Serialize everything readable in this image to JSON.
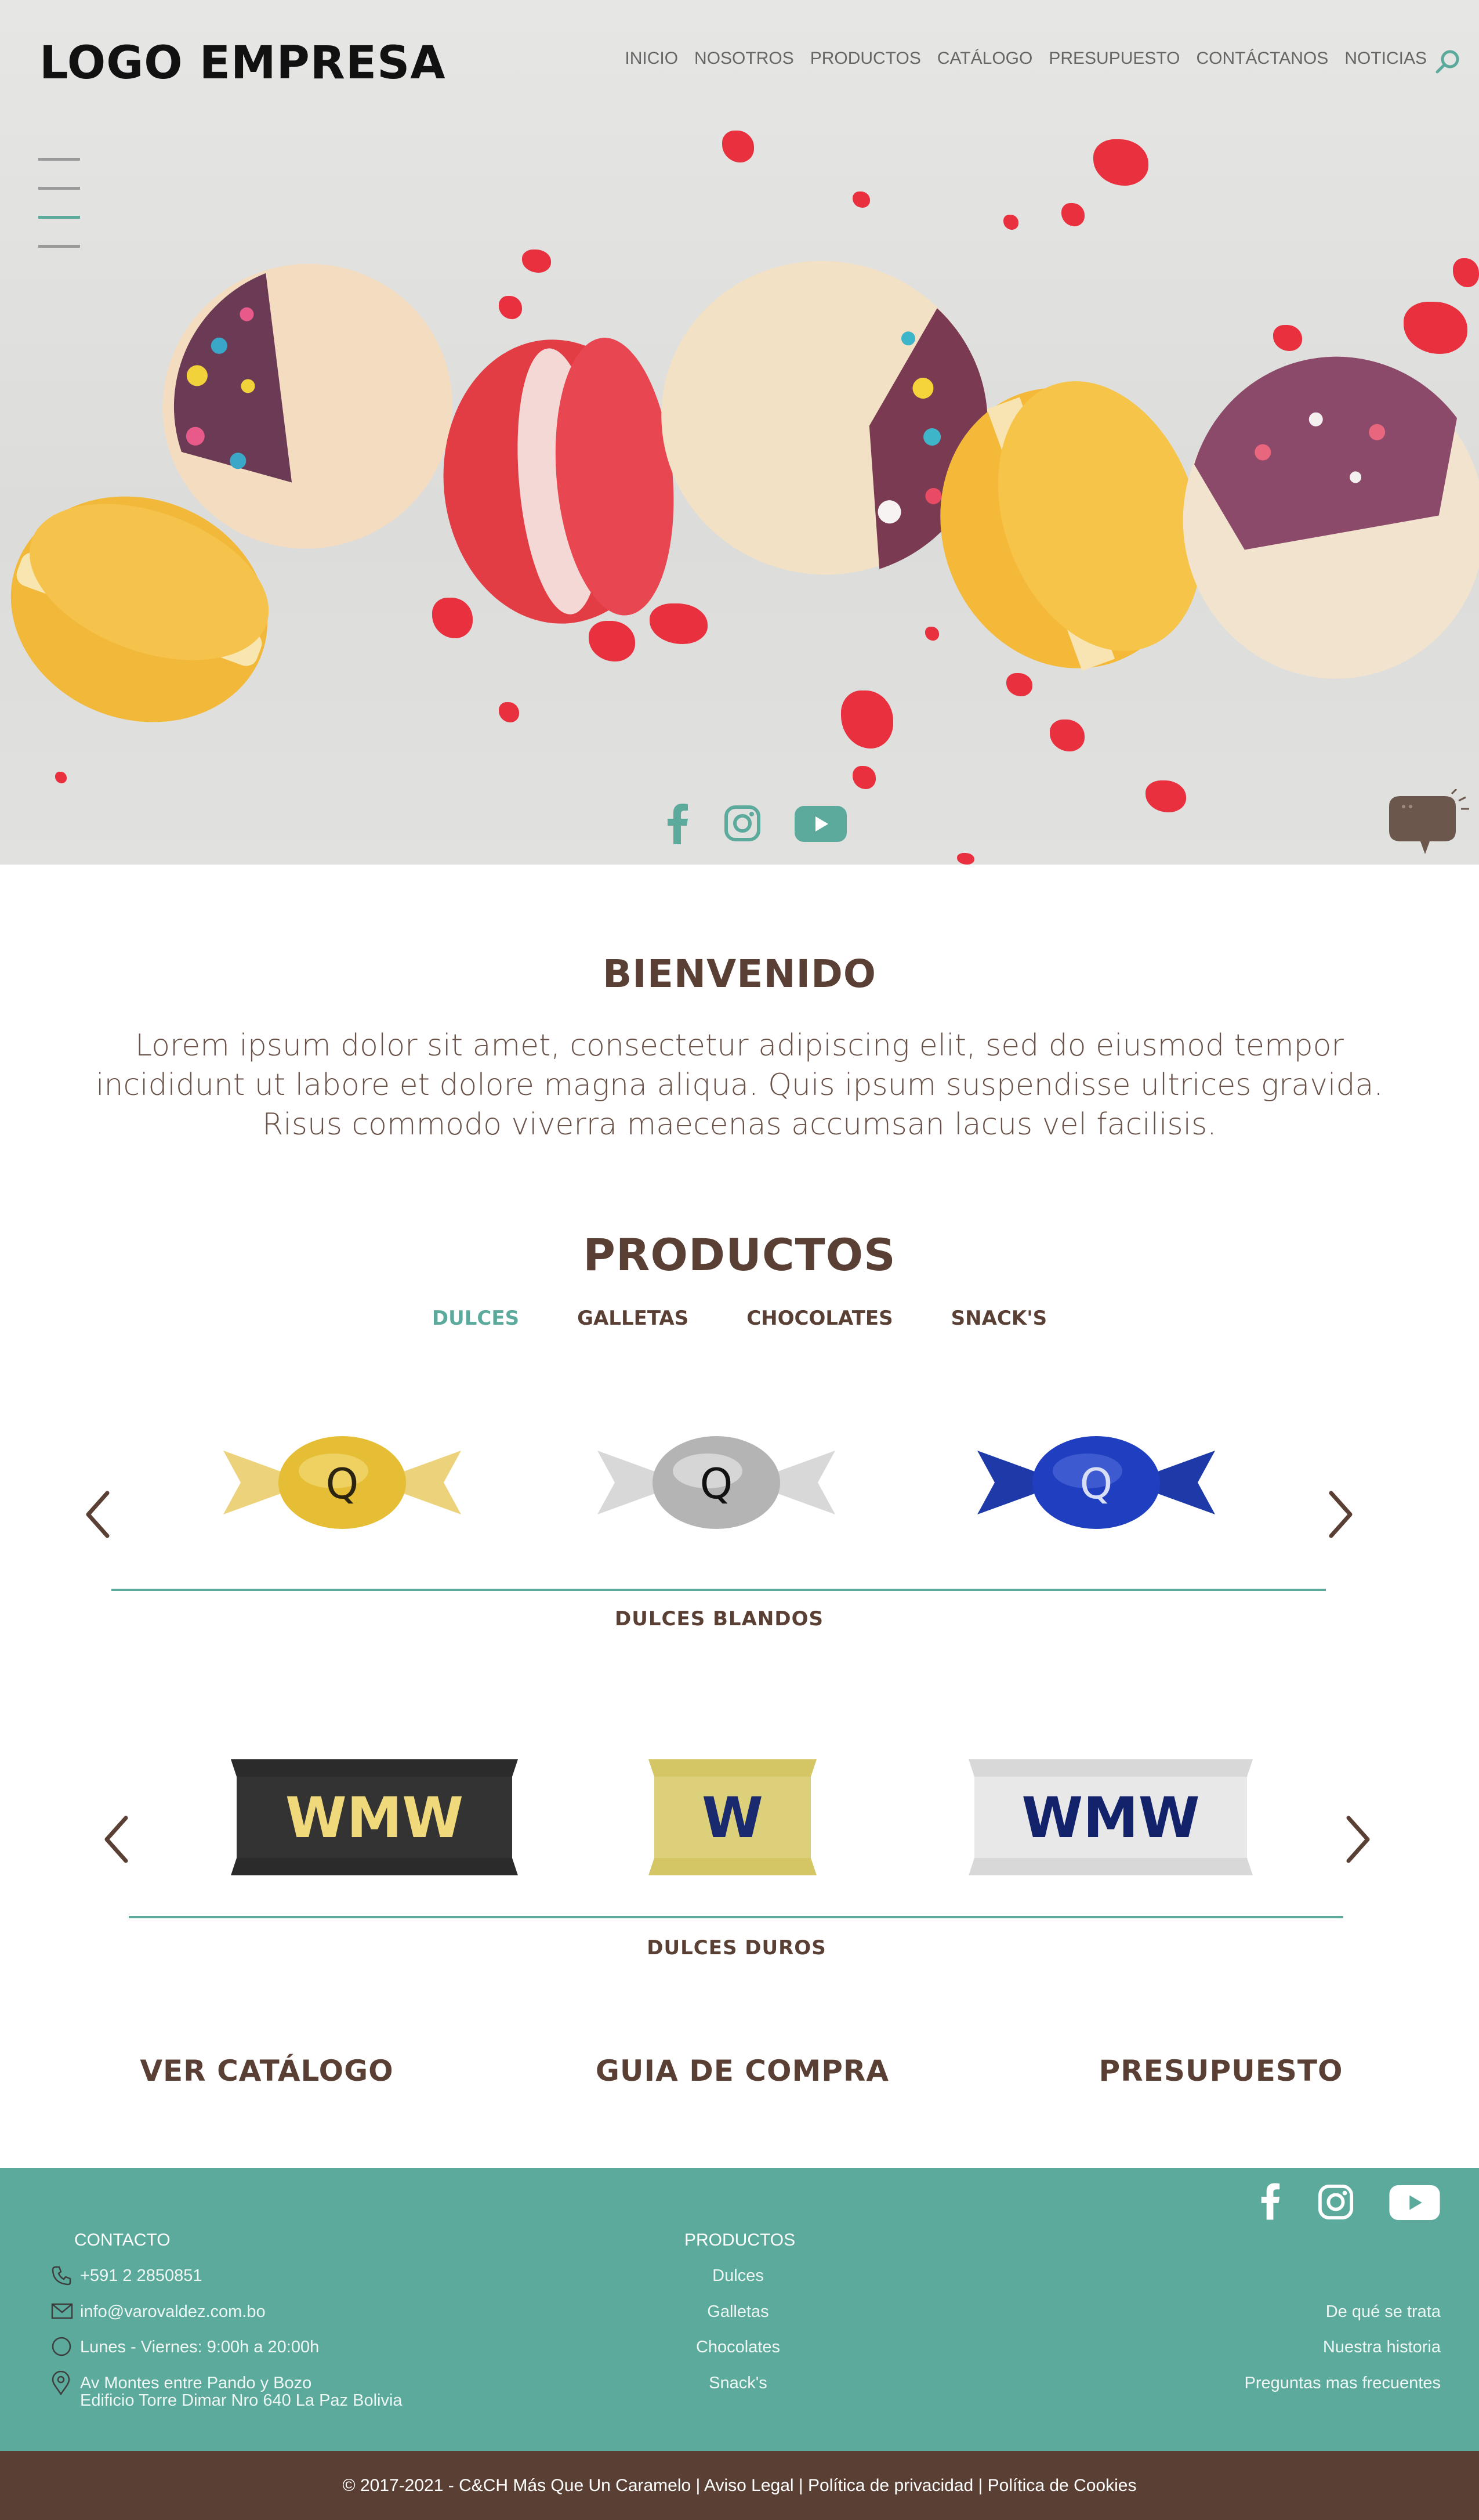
{
  "header": {
    "logo": "LOGO EMPRESA",
    "nav": [
      "INICIO",
      "NOSOTROS",
      "PRODUCTOS",
      "CATÁLOGO",
      "PRESUPUESTO",
      "CONTÁCTANOS",
      "NOTICIAS"
    ]
  },
  "hero": {
    "social_icons": [
      "facebook-icon",
      "instagram-icon",
      "youtube-icon"
    ],
    "chat_icon": "chat-bubble-icon"
  },
  "welcome": {
    "title": "BIENVENIDO",
    "text": "Lorem ipsum dolor sit amet, consectetur adipiscing elit, sed do eiusmod tempor incididunt ut labore et dolore magna aliqua. Quis ipsum suspendisse ultrices gravida. Risus commodo viverra maecenas accumsan lacus vel facilisis."
  },
  "products": {
    "title": "PRODUCTOS",
    "tabs": [
      "DULCES",
      "GALLETAS",
      "CHOCOLATES",
      "SNACK'S"
    ],
    "active_tab": "DULCES",
    "soft_candies": {
      "label": "DULCES BLANDOS",
      "items": [
        {
          "mark": "Q",
          "wrapper_color": "#e8c23c"
        },
        {
          "mark": "Q",
          "wrapper_color": "#b8b8b8"
        },
        {
          "mark": "Q",
          "wrapper_color": "#1f3fb8"
        }
      ]
    },
    "hard_candies": {
      "label": "DULCES DUROS",
      "items": [
        {
          "mark": "WMW",
          "wrapper_color": "#2b2b2b",
          "text_color": "#f0d97a"
        },
        {
          "mark": "W",
          "wrapper_color": "#d9cc6a",
          "text_color": "#1a2a6e"
        },
        {
          "mark": "WMW",
          "wrapper_color": "#e4e4e4",
          "text_color": "#13236b"
        }
      ]
    }
  },
  "cta": [
    "VER CATÁLOGO",
    "GUIA DE COMPRA",
    "PRESUPUESTO"
  ],
  "footer": {
    "contact_heading": "CONTACTO",
    "phone": "+591 2 2850851",
    "email": "info@varovaldez.com.bo",
    "hours": "Lunes - Viernes: 9:00h a 20:00h",
    "address_line1": "Av Montes entre Pando y Bozo",
    "address_line2": "Edificio Torre Dimar Nro 640 La Paz Bolivia",
    "products_heading": "PRODUCTOS",
    "product_links": [
      "Dulces",
      "Galletas",
      "Chocolates",
      "Snack's"
    ],
    "info_links": [
      "De qué se trata",
      "Nuestra historia",
      "Preguntas mas frecuentes"
    ],
    "copyright": "© 2017-2021 - C&CH Más Que Un Caramelo | Aviso Legal | Política de privacidad | Política de Cookies"
  },
  "colors": {
    "accent": "#5caa9c",
    "brown": "#5a4034"
  }
}
